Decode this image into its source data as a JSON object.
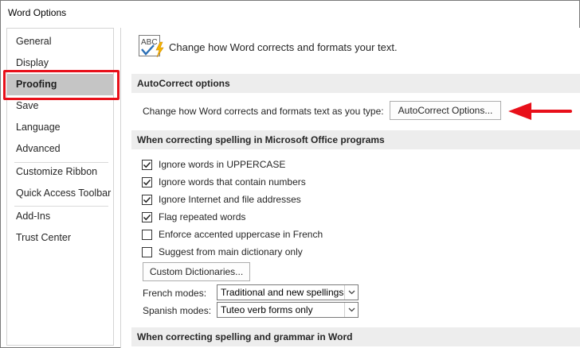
{
  "window": {
    "title": "Word Options"
  },
  "sidebar": {
    "items": [
      {
        "label": "General"
      },
      {
        "label": "Display"
      },
      {
        "label": "Proofing"
      },
      {
        "label": "Save"
      },
      {
        "label": "Language"
      },
      {
        "label": "Advanced"
      },
      {
        "label": "Customize Ribbon"
      },
      {
        "label": "Quick Access Toolbar"
      },
      {
        "label": "Add-Ins"
      },
      {
        "label": "Trust Center"
      }
    ],
    "selected": "Proofing"
  },
  "header": {
    "icon": "abc-check-icon",
    "text": "Change how Word corrects and formats your text."
  },
  "autocorrect": {
    "section_title": "AutoCorrect options",
    "description": "Change how Word corrects and formats text as you type:",
    "button_label": "AutoCorrect Options...",
    "accent_color": "#e8101a"
  },
  "spelling": {
    "section_title": "When correcting spelling in Microsoft Office programs",
    "options": [
      {
        "label": "Ignore words in UPPERCASE",
        "checked": true
      },
      {
        "label": "Ignore words that contain numbers",
        "checked": true
      },
      {
        "label": "Ignore Internet and file addresses",
        "checked": true
      },
      {
        "label": "Flag repeated words",
        "checked": true
      },
      {
        "label": "Enforce accented uppercase in French",
        "checked": false
      },
      {
        "label": "Suggest from main dictionary only",
        "checked": false
      }
    ],
    "custom_dictionaries_label": "Custom Dictionaries...",
    "french_modes": {
      "label": "French modes:",
      "value": "Traditional and new spellings"
    },
    "spanish_modes": {
      "label": "Spanish modes:",
      "value": "Tuteo verb forms only"
    }
  },
  "grammar": {
    "section_title": "When correcting spelling and grammar in Word"
  }
}
